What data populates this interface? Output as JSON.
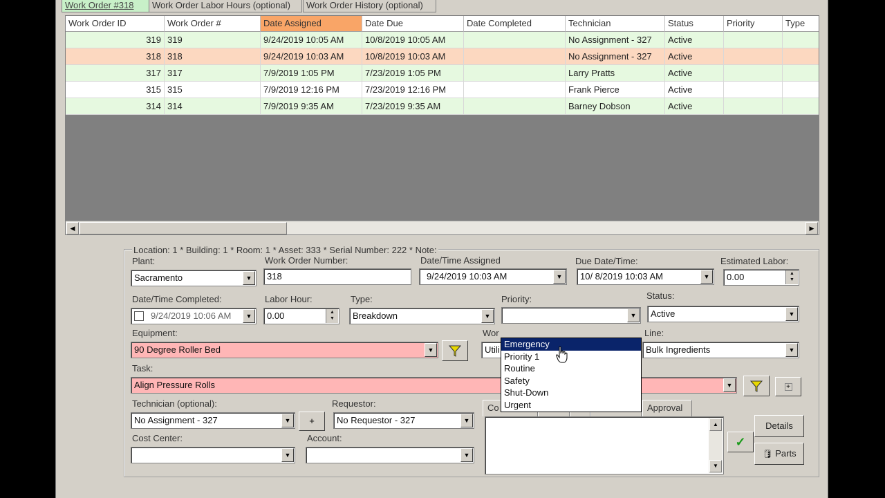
{
  "tabs": [
    {
      "label": "Work Order #318"
    },
    {
      "label": "Work Order Labor Hours (optional)"
    },
    {
      "label": "Work Order History (optional)"
    }
  ],
  "grid": {
    "columns": [
      "Work Order ID",
      "Work Order #",
      "Date Assigned",
      "Date Due",
      "Date Completed",
      "Technician",
      "Status",
      "Priority",
      "Type"
    ],
    "rows": [
      {
        "id": "319",
        "num": "319",
        "assigned": "9/24/2019 10:05 AM",
        "due": "10/8/2019 10:05 AM",
        "completed": "",
        "tech": "No Assignment - 327",
        "status": "Active",
        "priority": "",
        "type": ""
      },
      {
        "id": "318",
        "num": "318",
        "assigned": "9/24/2019 10:03 AM",
        "due": "10/8/2019 10:03 AM",
        "completed": "",
        "tech": "No Assignment - 327",
        "status": "Active",
        "priority": "",
        "type": ""
      },
      {
        "id": "317",
        "num": "317",
        "assigned": "7/9/2019 1:05 PM",
        "due": "7/23/2019 1:05 PM",
        "completed": "",
        "tech": "Larry Pratts",
        "status": "Active",
        "priority": "",
        "type": ""
      },
      {
        "id": "315",
        "num": "315",
        "assigned": "7/9/2019 12:16 PM",
        "due": "7/23/2019 12:16 PM",
        "completed": "",
        "tech": "Frank Pierce",
        "status": "Active",
        "priority": "",
        "type": ""
      },
      {
        "id": "314",
        "num": "314",
        "assigned": "7/9/2019 9:35 AM",
        "due": "7/23/2019 9:35 AM",
        "completed": "",
        "tech": "Barney Dobson",
        "status": "Active",
        "priority": "",
        "type": ""
      }
    ],
    "row_colors": [
      "#e6f9e0",
      "#fcd8c0",
      "#e6f9e0",
      "#ffffff",
      "#e6f9e0"
    ]
  },
  "form": {
    "location_note": "Location: 1 * Building: 1 * Room: 1 * Asset: 333 * Serial Number: 222 * Note:",
    "plant_label": "Plant:",
    "plant_value": "Sacramento",
    "wo_number_label": "Work Order Number:",
    "wo_number_value": "318",
    "assigned_label": "Date/Time Assigned",
    "assigned_value": "9/24/2019 10:03 AM",
    "due_label": "Due Date/Time:",
    "due_value": "10/  8/2019 10:03 AM",
    "est_labor_label": "Estimated Labor:",
    "est_labor_value": "0.00",
    "completed_label": "Date/Time Completed:",
    "completed_value": "9/24/2019 10:06 AM",
    "labor_hour_label": "Labor Hour:",
    "labor_hour_value": "0.00",
    "type_label": "Type:",
    "type_value": "Breakdown",
    "priority_label": "Priority:",
    "priority_value": "",
    "status_label": "Status:",
    "status_value": "Active",
    "equipment_label": "Equipment:",
    "equipment_value": "90 Degree Roller Bed",
    "work_label": "Wor",
    "work_value": "Utili",
    "line_label": "Line:",
    "line_value": "Bulk Ingredients",
    "task_label": "Task:",
    "task_value": "Align Pressure Rolls",
    "technician_label": "Technician (optional):",
    "technician_value": "No Assignment - 327",
    "requestor_label": "Requestor:",
    "requestor_value": "No Requestor - 327",
    "cost_center_label": "Cost Center:",
    "cost_center_value": "",
    "account_label": "Account:",
    "account_value": "",
    "plus_label": "+",
    "subtabs": [
      {
        "label": "Co"
      },
      {
        "label": ""
      },
      {
        "label": ""
      },
      {
        "label": ""
      },
      {
        "label": "Approval"
      }
    ],
    "details_label": "Details",
    "parts_label": "Parts"
  },
  "priority_dropdown": {
    "options": [
      "Emergency",
      "Priority 1",
      "Routine",
      "Safety",
      "Shut-Down",
      "Urgent"
    ],
    "highlighted": "Emergency"
  },
  "colors": {
    "sorted_header": "#f9a567",
    "required_field": "#ffb6b6",
    "active_tab": "#c8f0c8",
    "highlight": "#0a246a"
  }
}
